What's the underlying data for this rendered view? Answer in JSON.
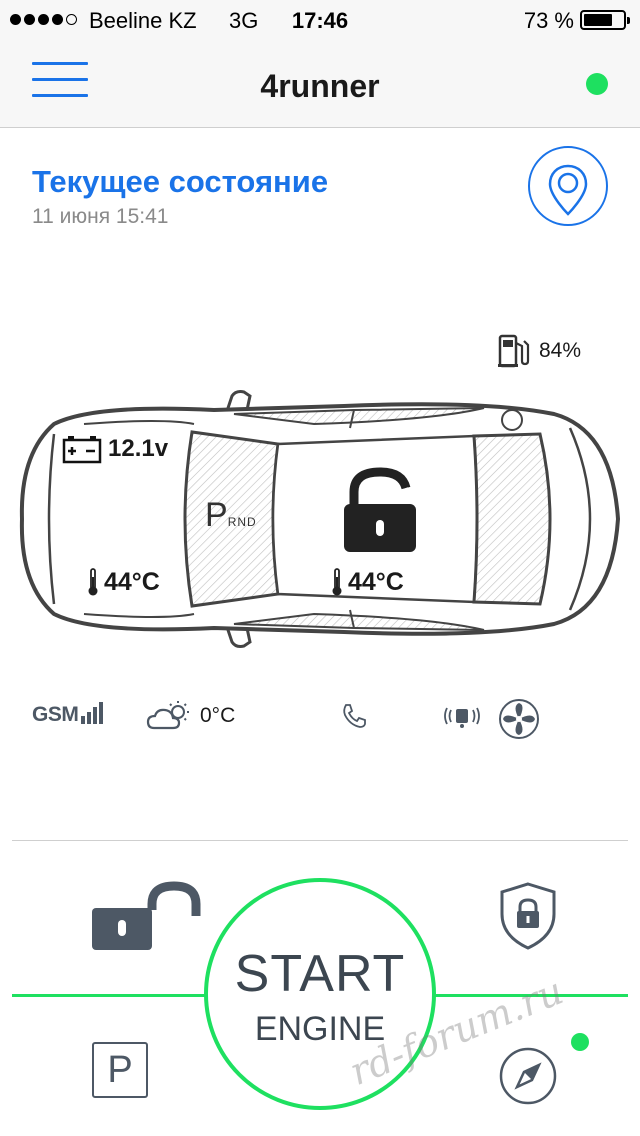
{
  "status_bar": {
    "carrier": "Beeline KZ",
    "network": "3G",
    "time": "17:46",
    "battery_percent": "73 %",
    "battery_level": 0.73,
    "signal_strength": 4,
    "signal_max": 5
  },
  "nav": {
    "title": "4runner",
    "menu_icon": "hamburger-menu-icon",
    "online_status_color": "#1ee060"
  },
  "header": {
    "title": "Текущее состояние",
    "date": "11 июня 15:41",
    "location_icon": "map-pin-icon"
  },
  "car": {
    "fuel": "84%",
    "battery_voltage": "12.1v",
    "gear_selected": "P",
    "gear_other": "RND",
    "engine_temp": "44°C",
    "cabin_temp": "44°C",
    "lock_state_icon": "unlocked-padlock-icon"
  },
  "sensors": {
    "gsm_label": "GSM",
    "gsm_bars": 4,
    "outside_temp": "0°C",
    "weather_icon": "partly-cloudy-icon",
    "phone_icon": "phone-icon",
    "vibration_icon": "vibration-sensor-icon",
    "fan_icon": "fan-icon"
  },
  "controls": {
    "start_label": "START",
    "engine_label": "ENGINE",
    "parking_label": "P",
    "unlock_icon": "unlock-icon",
    "arm_icon": "shield-lock-icon",
    "compass_icon": "compass-icon"
  },
  "watermark": "rd-forum.ru",
  "colors": {
    "accent": "#1a73e8",
    "online": "#1ee060",
    "icon_gray": "#4d5865"
  }
}
